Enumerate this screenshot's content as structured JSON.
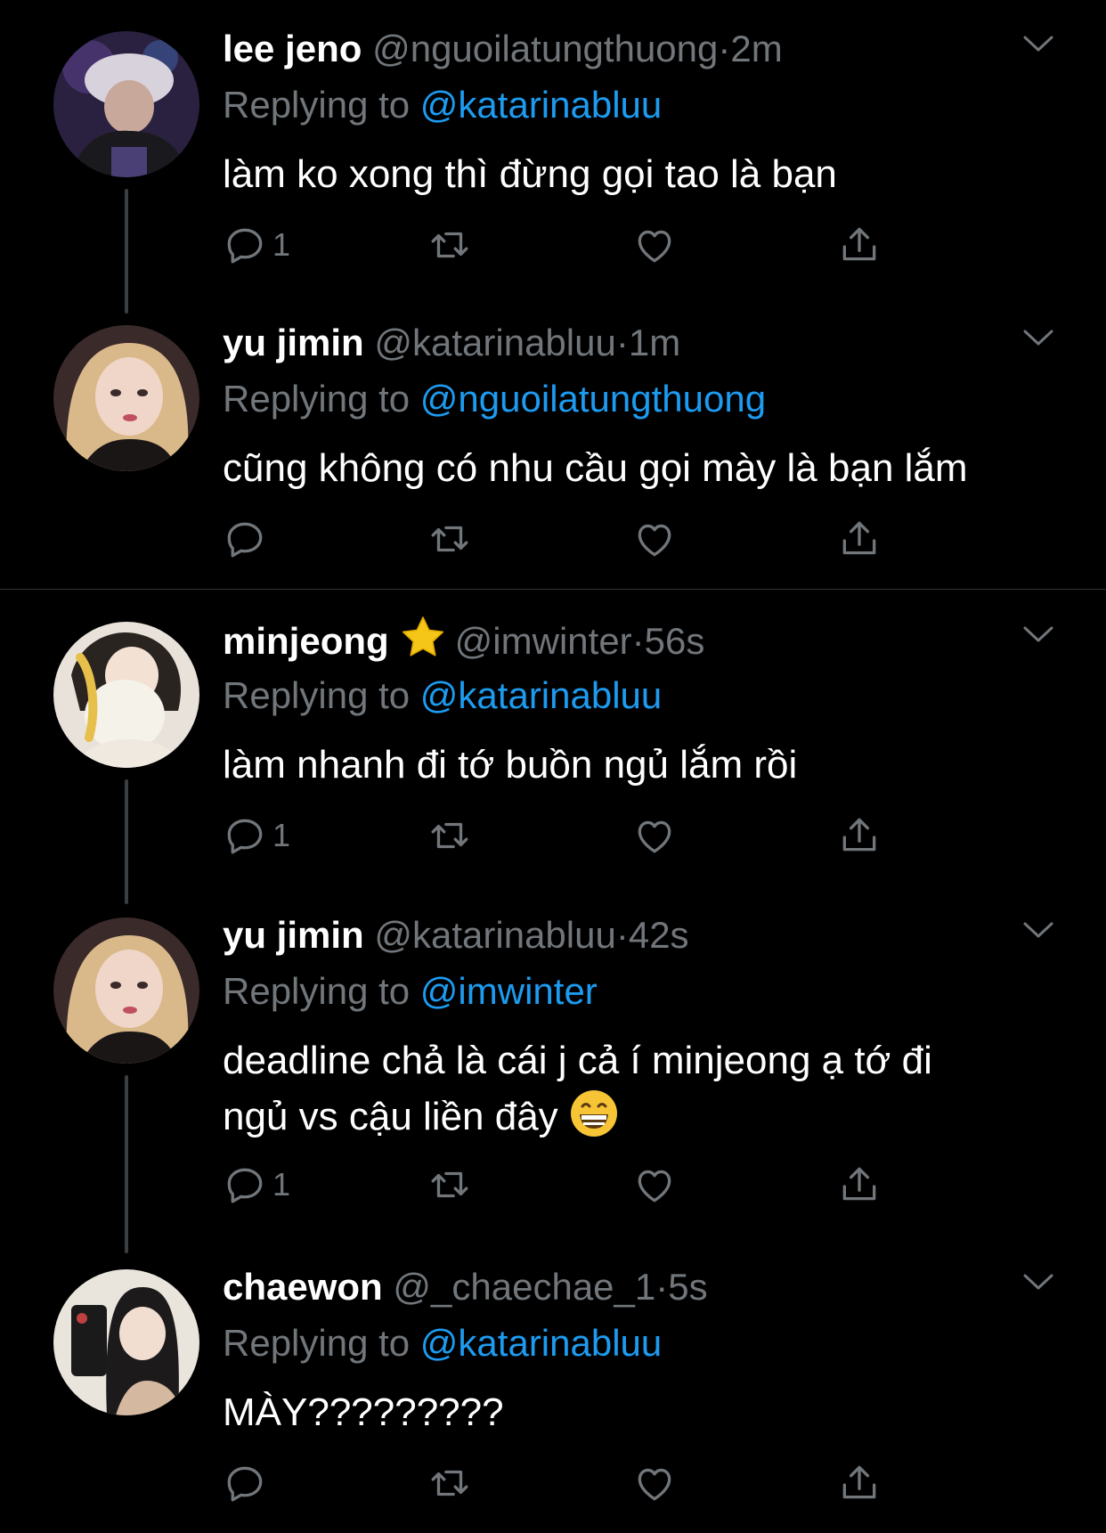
{
  "colors": {
    "background": "#000000",
    "text_primary": "#ffffff",
    "text_secondary": "#71767b",
    "mention": "#1d9bf0",
    "divider": "#2f3336"
  },
  "tweets": [
    {
      "name": "lee jeno",
      "handle": "@nguoilatungthuong",
      "dot": "·",
      "time": "2m",
      "replying_label": "Replying to",
      "replying_to": "@katarinabluu",
      "text": "làm ko xong thì đừng gọi tao là bạn",
      "reply_count": "1"
    },
    {
      "name": "yu jimin",
      "handle": "@katarinabluu",
      "dot": "·",
      "time": "1m",
      "replying_label": "Replying to",
      "replying_to": "@nguoilatungthuong",
      "text": "cũng không có nhu cầu gọi mày là bạn lắm",
      "reply_count": ""
    },
    {
      "name": "minjeong",
      "handle": "@imwinter",
      "dot": "·",
      "time": "56s",
      "replying_label": "Replying to",
      "replying_to": "@katarinabluu",
      "text": "làm nhanh đi tớ buồn ngủ lắm rồi",
      "reply_count": "1",
      "badge": "star-icon"
    },
    {
      "name": "yu jimin",
      "handle": "@katarinabluu",
      "dot": "·",
      "time": "42s",
      "replying_label": "Replying to",
      "replying_to": "@imwinter",
      "text_line1": "deadline chả là cái j cả í minjeong ạ tớ đi",
      "text_line2": "ngủ vs cậu liền đây",
      "emoji": "grinning-face-icon",
      "reply_count": "1"
    },
    {
      "name": "chaewon",
      "handle": "@_chaechae_1",
      "dot": "·",
      "time": "5s",
      "replying_label": "Replying to",
      "replying_to": "@katarinabluu",
      "text": "MÀY?????????",
      "reply_count": ""
    }
  ]
}
